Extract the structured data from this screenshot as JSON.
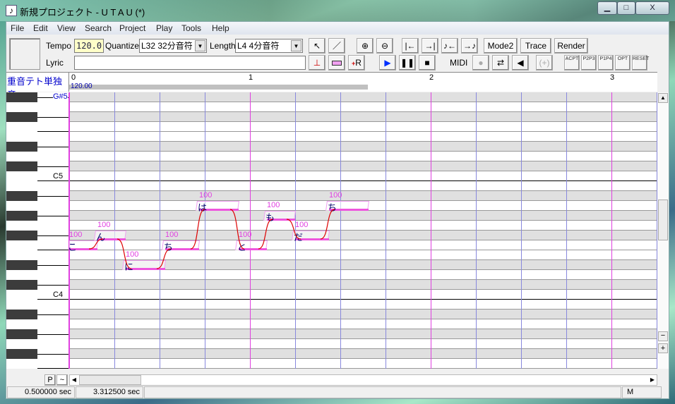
{
  "window": {
    "title": "新規プロジェクト - U T A U (*)",
    "minimize": "▁",
    "maximize": "□",
    "close": "X"
  },
  "menu": [
    "File",
    "Edit",
    "View",
    "Search",
    "Project",
    "Play",
    "Tools",
    "Help"
  ],
  "toolbar": {
    "tempo_label": "Tempo",
    "tempo_value": "120.0",
    "quantize_label": "Quantize",
    "quantize_value": "L32 32分音符",
    "length_label": "Length",
    "length_value": "L4  4分音符",
    "lyric_label": "Lyric",
    "lyric_value": "",
    "mode2": "Mode2",
    "trace": "Trace",
    "render": "Render",
    "midi": "MIDI",
    "env_buttons": [
      "ACPT",
      "P2P3",
      "P1P4",
      "OPT",
      "RESET"
    ]
  },
  "track": {
    "singer": "重音テト単独音",
    "tempo_marker": "120.00",
    "measures": [
      "0",
      "1",
      "2",
      "3"
    ]
  },
  "keys": {
    "top_note": "G#5",
    "labels": [
      {
        "row": 8,
        "text": "C5"
      },
      {
        "row": 20,
        "text": "C4"
      }
    ]
  },
  "notes": [
    {
      "lyric": "こ",
      "pitch": "F4",
      "row": 15,
      "start": 0,
      "len": 300,
      "vel": "100"
    },
    {
      "lyric": "ん",
      "pitch": "F#4",
      "row": 14,
      "start": 300,
      "len": 300,
      "vel": "100"
    },
    {
      "lyric": "に",
      "pitch": "D#4",
      "row": 17,
      "start": 600,
      "len": 420,
      "vel": "100"
    },
    {
      "lyric": "ち",
      "pitch": "F4",
      "row": 15,
      "start": 1020,
      "len": 360,
      "vel": "100"
    },
    {
      "lyric": "は",
      "pitch": "A4",
      "row": 11,
      "start": 1380,
      "len": 420,
      "vel": "100"
    },
    {
      "lyric": "と",
      "pitch": "F4",
      "row": 15,
      "start": 1800,
      "len": 300,
      "vel": "100"
    },
    {
      "lyric": "も",
      "pitch": "G#4",
      "row": 12,
      "start": 2100,
      "len": 300,
      "vel": "100"
    },
    {
      "lyric": "だ",
      "pitch": "F#4",
      "row": 14,
      "start": 2400,
      "len": 360,
      "vel": "100"
    },
    {
      "lyric": "ち",
      "pitch": "A4",
      "row": 11,
      "start": 2760,
      "len": 420,
      "vel": "100"
    }
  ],
  "bottom": {
    "p_button": "P",
    "tilde_button": "~"
  },
  "status": {
    "cursor_time": "0.500000 sec",
    "total_time": "3.312500 sec",
    "mode": "M"
  },
  "colors": {
    "measure_line": "#e040e0",
    "beat_line": "#8888dd",
    "black_row": "#e0e0e0",
    "pitch_curve": "#dd0000"
  }
}
